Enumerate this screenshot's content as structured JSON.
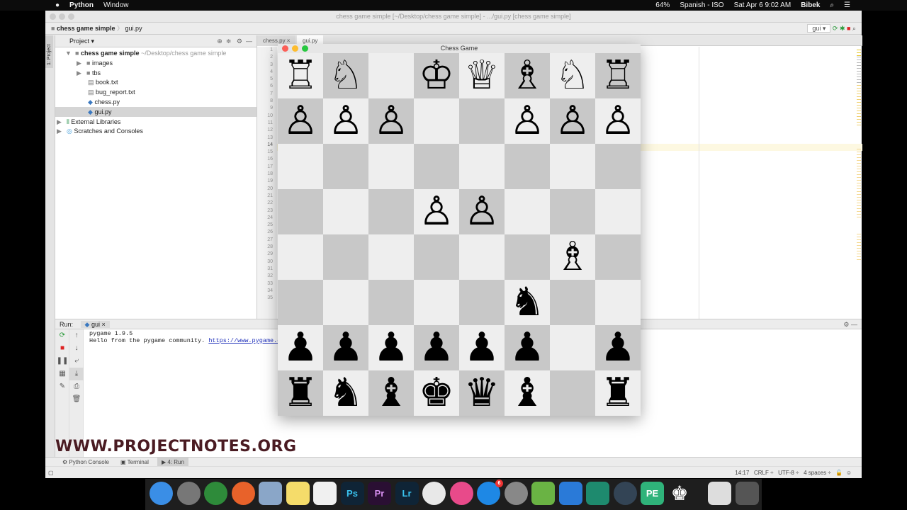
{
  "menubar": {
    "app": "Python",
    "items": [
      "Window"
    ],
    "battery": "64%",
    "input_source": "Spanish - ISO",
    "datetime": "Sat Apr 6  9:02 AM",
    "user": "Bibek"
  },
  "window": {
    "title": "chess game simple [~/Desktop/chess game simple] - .../gui.py [chess game simple]"
  },
  "breadcrumb": {
    "project": "chess game simple",
    "file": "gui.py"
  },
  "toolbar": {
    "run_config": "gui"
  },
  "project_panel": {
    "title": "Project",
    "strip_label": "1: Project",
    "tree": [
      {
        "label": "chess game simple",
        "hint": "~/Desktop/chess game simple",
        "type": "root"
      },
      {
        "label": "images",
        "type": "folder"
      },
      {
        "label": "tbs",
        "type": "folder"
      },
      {
        "label": "book.txt",
        "type": "file"
      },
      {
        "label": "bug_report.txt",
        "type": "file"
      },
      {
        "label": "chess.py",
        "type": "py"
      },
      {
        "label": "gui.py",
        "type": "py",
        "selected": true
      },
      {
        "label": "External Libraries",
        "type": "lib"
      },
      {
        "label": "Scratches and Consoles",
        "type": "scratch"
      }
    ]
  },
  "editor": {
    "tabs": [
      "chess.py",
      "gui.py"
    ],
    "active_tab": "gui.py",
    "line_count": 35,
    "current_line": 14
  },
  "run_panel": {
    "label": "Run:",
    "tab": "gui",
    "output": [
      "pygame 1.9.5",
      "Hello from the pygame community. "
    ],
    "link": "https://www.pygame.org/"
  },
  "watermark": "WWW.PROJECTNOTES.ORG",
  "bottom_tabs": [
    "Python Console",
    "Terminal",
    "4: Run"
  ],
  "statusbar": {
    "position": "14:17",
    "line_sep": "CRLF ÷",
    "encoding": "UTF-8 ÷",
    "indent": "4 spaces ÷"
  },
  "chess_window": {
    "title": "Chess Game",
    "light_color": "#eeeeee",
    "dark_color": "#c8c8c8",
    "board": [
      [
        "wR",
        "wN",
        "",
        "wK",
        "wQ",
        "wB",
        "wN",
        "wR"
      ],
      [
        "wP",
        "wP",
        "wP",
        "",
        "",
        "wP",
        "wP",
        "wP"
      ],
      [
        "",
        "",
        "",
        "",
        "",
        "",
        "",
        ""
      ],
      [
        "",
        "",
        "",
        "wP",
        "wP",
        "",
        "",
        ""
      ],
      [
        "",
        "",
        "",
        "",
        "",
        "",
        "wB",
        ""
      ],
      [
        "",
        "",
        "",
        "",
        "",
        "bN",
        "",
        ""
      ],
      [
        "bP",
        "bP",
        "bP",
        "bP",
        "bP",
        "bP",
        "",
        "bP"
      ],
      [
        "bR",
        "bN",
        "bB",
        "bK",
        "bQ",
        "bB",
        "",
        "bR"
      ]
    ]
  },
  "dock": [
    {
      "name": "finder",
      "color": "#3a8ee6",
      "label": ""
    },
    {
      "name": "launchpad",
      "color": "#777777",
      "label": ""
    },
    {
      "name": "chrome",
      "color": "#2e8b3a",
      "label": ""
    },
    {
      "name": "firefox",
      "color": "#e8622a",
      "label": ""
    },
    {
      "name": "mail",
      "color": "#8aa6c8",
      "label": ""
    },
    {
      "name": "notes",
      "color": "#f5dc6a",
      "label": ""
    },
    {
      "name": "reminders",
      "color": "#f0f0f0",
      "label": ""
    },
    {
      "name": "photoshop",
      "color": "#0f2436",
      "label": "Ps"
    },
    {
      "name": "premiere",
      "color": "#2a0f33",
      "label": "Pr"
    },
    {
      "name": "lightroom",
      "color": "#0f2436",
      "label": "Lr"
    },
    {
      "name": "photos",
      "color": "#e8e8e8",
      "label": ""
    },
    {
      "name": "itunes",
      "color": "#e84a8a",
      "label": ""
    },
    {
      "name": "app-store",
      "color": "#1e88e5",
      "label": "",
      "badge": "6"
    },
    {
      "name": "system-preferences",
      "color": "#888888",
      "label": ""
    },
    {
      "name": "android-studio",
      "color": "#6ab344",
      "label": ""
    },
    {
      "name": "xcode",
      "color": "#2a7ad8",
      "label": ""
    },
    {
      "name": "dashlane",
      "color": "#1e8a6e",
      "label": ""
    },
    {
      "name": "quicktime",
      "color": "#334455",
      "label": ""
    },
    {
      "name": "pycharm-edu",
      "color": "#2fb37a",
      "label": "PE"
    },
    {
      "name": "chess",
      "color": "#1e1e1e",
      "label": "♚"
    },
    {
      "name": "preview-window",
      "color": "#dddddd",
      "label": ""
    },
    {
      "name": "trash",
      "color": "#555555",
      "label": ""
    }
  ]
}
